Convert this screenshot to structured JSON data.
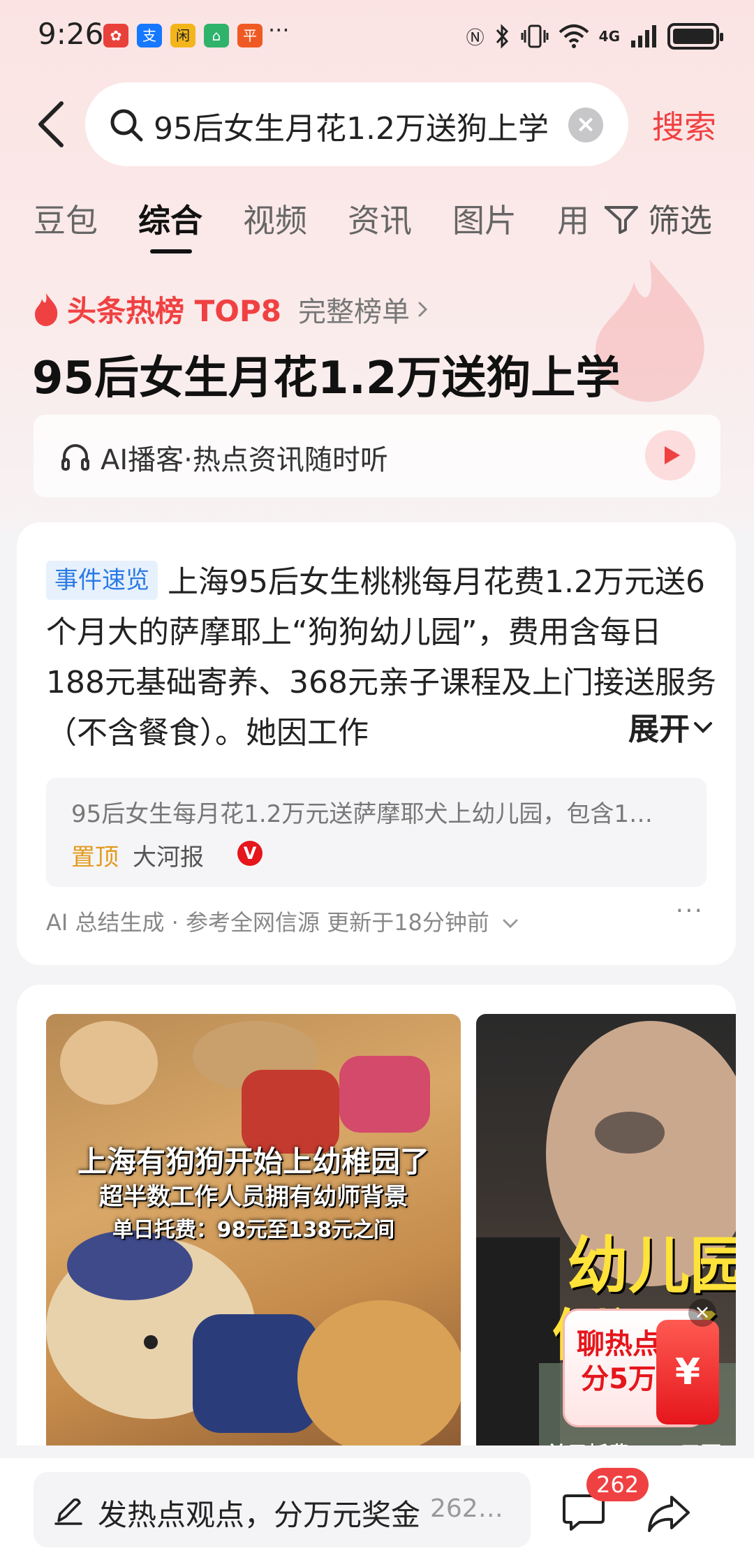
{
  "status_bar": {
    "time": "9:26",
    "app_icons": [
      {
        "icon": "app-red-icon",
        "color": "#e8413c",
        "glyph": "✿"
      },
      {
        "icon": "alipay-icon",
        "color": "#1677ff",
        "glyph": "支"
      },
      {
        "icon": "app-yellow-icon",
        "color": "#f2b61c",
        "glyph": "闲"
      },
      {
        "icon": "app-green-icon",
        "color": "#2fb36b",
        "glyph": "⌂"
      },
      {
        "icon": "pingan-bank-icon",
        "color": "#ef5a24",
        "glyph": "平"
      }
    ],
    "more": "···",
    "network": "4G"
  },
  "search": {
    "query": "95后女生月花1.2万送狗上学",
    "clear_icon": "×",
    "button": "搜索"
  },
  "tabs": [
    {
      "label": "豆包",
      "active": false
    },
    {
      "label": "综合",
      "active": true
    },
    {
      "label": "视频",
      "active": false
    },
    {
      "label": "资讯",
      "active": false
    },
    {
      "label": "图片",
      "active": false
    },
    {
      "label": "用",
      "active": false
    }
  ],
  "filter": {
    "label": "筛选"
  },
  "hot": {
    "title": "头条热榜 TOP8",
    "more": "完整榜单",
    "heading": "95后女生月花1.2万送狗上学"
  },
  "podcast": {
    "text": "AI播客·热点资讯随时听"
  },
  "summary": {
    "tag": "事件速览",
    "text": "上海95后女生桃桃每月花费1.2万元送6个月大的萨摩耶上“狗狗幼儿园”，费用含每日188元基础寄养、368元亲子课程及上门接送服务（不含餐食）。她因工作",
    "expand": "展开",
    "source_title": "95后女生每月花1.2万元送萨摩耶犬上幼儿园，包含1…",
    "source_pin": "置顶",
    "source_media": "大河报",
    "verified": "V",
    "ai_note": "AI 总结生成 · 参考全网信源 更新于18分钟前",
    "more": "···"
  },
  "videos": [
    {
      "lines": [
        "上海有狗狗开始上幼稚园了",
        "超半数工作人员拥有幼师背景",
        "单日托费：98元至138元之间"
      ]
    },
    {
      "big_lines": [
        "幼儿园",
        "倒闭了"
      ],
      "caption": "单日托费：98元至13"
    }
  ],
  "envelope": {
    "text": "聊热点分5万",
    "symbol": "¥",
    "close": "×"
  },
  "bottom": {
    "placeholder": "发热点观点，分万元奖金",
    "count": "262…",
    "comment_count": "262"
  },
  "colors": {
    "accent": "#f04142",
    "tag_blue": "#2a7ae4",
    "pin_orange": "#e39a1e"
  }
}
